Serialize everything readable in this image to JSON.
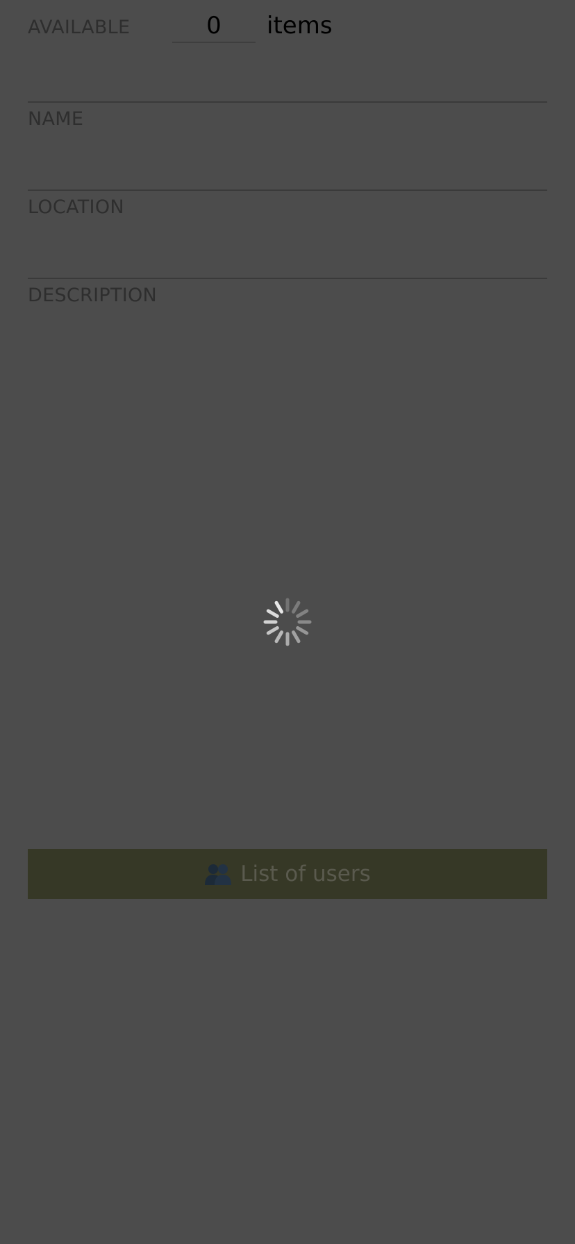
{
  "availability": {
    "label": "AVAILABLE",
    "quantity": "0",
    "unit": "items"
  },
  "fields": {
    "name_label": "NAME",
    "location_label": "LOCATION",
    "description_label": "DESCRIPTION"
  },
  "loading": {
    "icon": "spinner-icon",
    "color": "#e0e0e0"
  },
  "footer": {
    "users_button_label": "List of users",
    "users_icon": "users-icon",
    "button_color": "#363826"
  }
}
